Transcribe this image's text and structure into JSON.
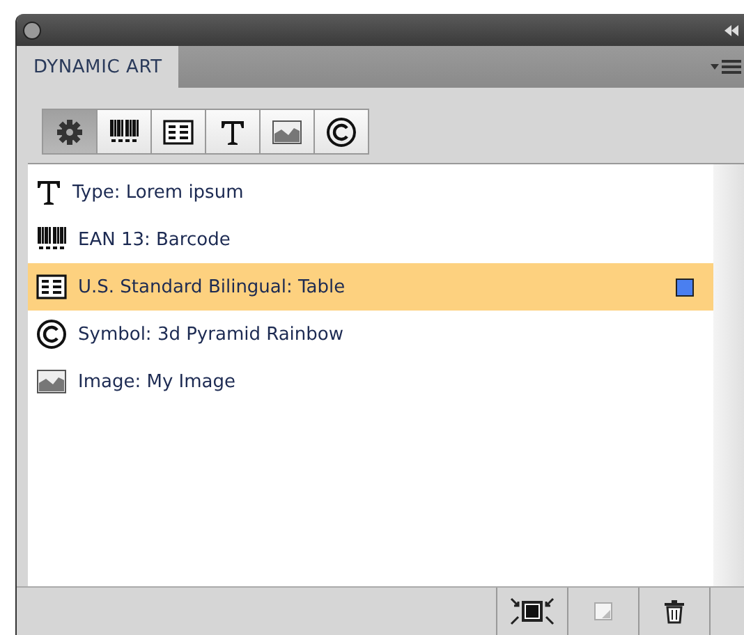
{
  "panel": {
    "tab": "DYNAMIC ART"
  },
  "toolbar": [
    {
      "kind": "gear",
      "selected": true
    },
    {
      "kind": "barcode",
      "selected": false
    },
    {
      "kind": "table",
      "selected": false
    },
    {
      "kind": "type",
      "selected": false
    },
    {
      "kind": "image",
      "selected": false
    },
    {
      "kind": "symbol",
      "selected": false
    }
  ],
  "items": [
    {
      "kind": "type",
      "label": "Type: Lorem ipsum",
      "selected": false,
      "marked": false
    },
    {
      "kind": "barcode",
      "label": "EAN 13: Barcode",
      "selected": false,
      "marked": false
    },
    {
      "kind": "table",
      "label": "U.S. Standard Bilingual: Table",
      "selected": true,
      "marked": true
    },
    {
      "kind": "symbol",
      "label": "Symbol: 3d Pyramid Rainbow",
      "selected": false,
      "marked": false
    },
    {
      "kind": "image",
      "label": "Image: My Image",
      "selected": false,
      "marked": false
    }
  ],
  "footer": [
    {
      "kind": "fit"
    },
    {
      "kind": "new"
    },
    {
      "kind": "delete"
    }
  ]
}
